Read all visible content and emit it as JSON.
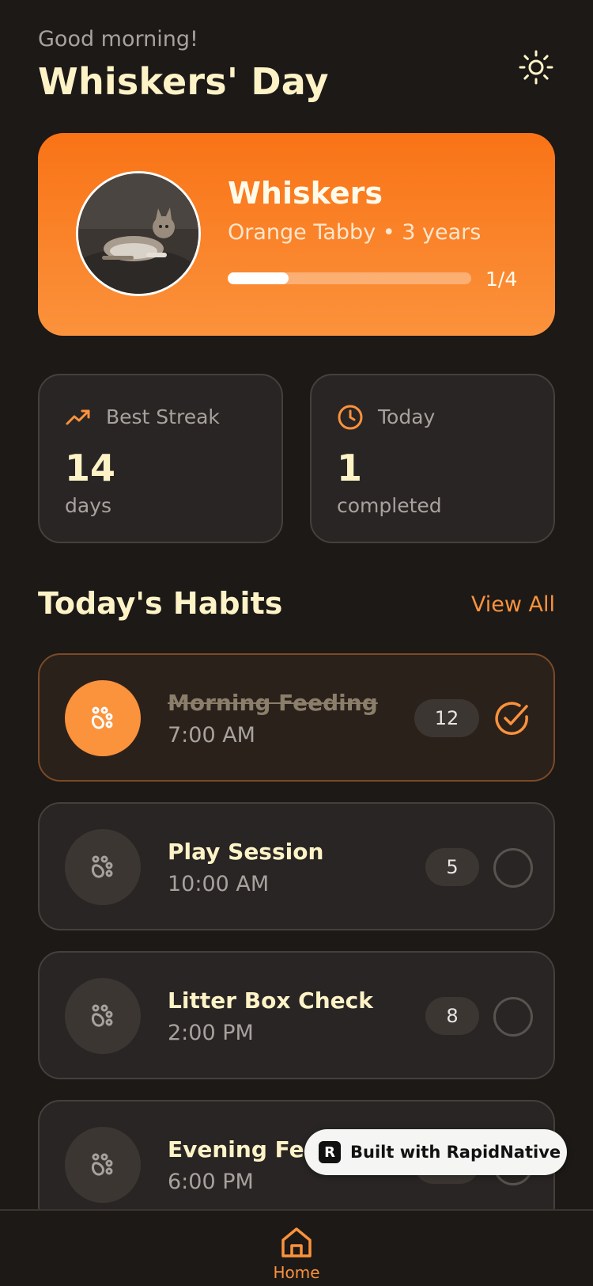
{
  "header": {
    "greeting": "Good morning!",
    "title": "Whiskers' Day",
    "theme_icon": "sun-icon"
  },
  "pet": {
    "name": "Whiskers",
    "details": "Orange Tabby • 3 years",
    "progress_label": "1/4",
    "progress_fraction": 0.25
  },
  "stats": [
    {
      "icon": "trending-up-icon",
      "label": "Best Streak",
      "value": "14",
      "unit": "days"
    },
    {
      "icon": "clock-icon",
      "label": "Today",
      "value": "1",
      "unit": "completed"
    }
  ],
  "habits_section": {
    "title": "Today's Habits",
    "view_all": "View All"
  },
  "habits": [
    {
      "name": "Morning Feeding",
      "time": "7:00 AM",
      "streak": "12",
      "done": true
    },
    {
      "name": "Play Session",
      "time": "10:00 AM",
      "streak": "5",
      "done": false
    },
    {
      "name": "Litter Box Check",
      "time": "2:00 PM",
      "streak": "8",
      "done": false
    },
    {
      "name": "Evening Feeding",
      "time": "6:00 PM",
      "streak": "",
      "done": false
    }
  ],
  "badge": {
    "logo": "R",
    "text": "Built with RapidNative"
  },
  "tabbar": {
    "home_label": "Home"
  },
  "colors": {
    "background": "#1c1917",
    "accent": "#fb923c",
    "accent_dark": "#f97316",
    "text_primary": "#fef3c7",
    "text_secondary": "#a8a29e"
  }
}
